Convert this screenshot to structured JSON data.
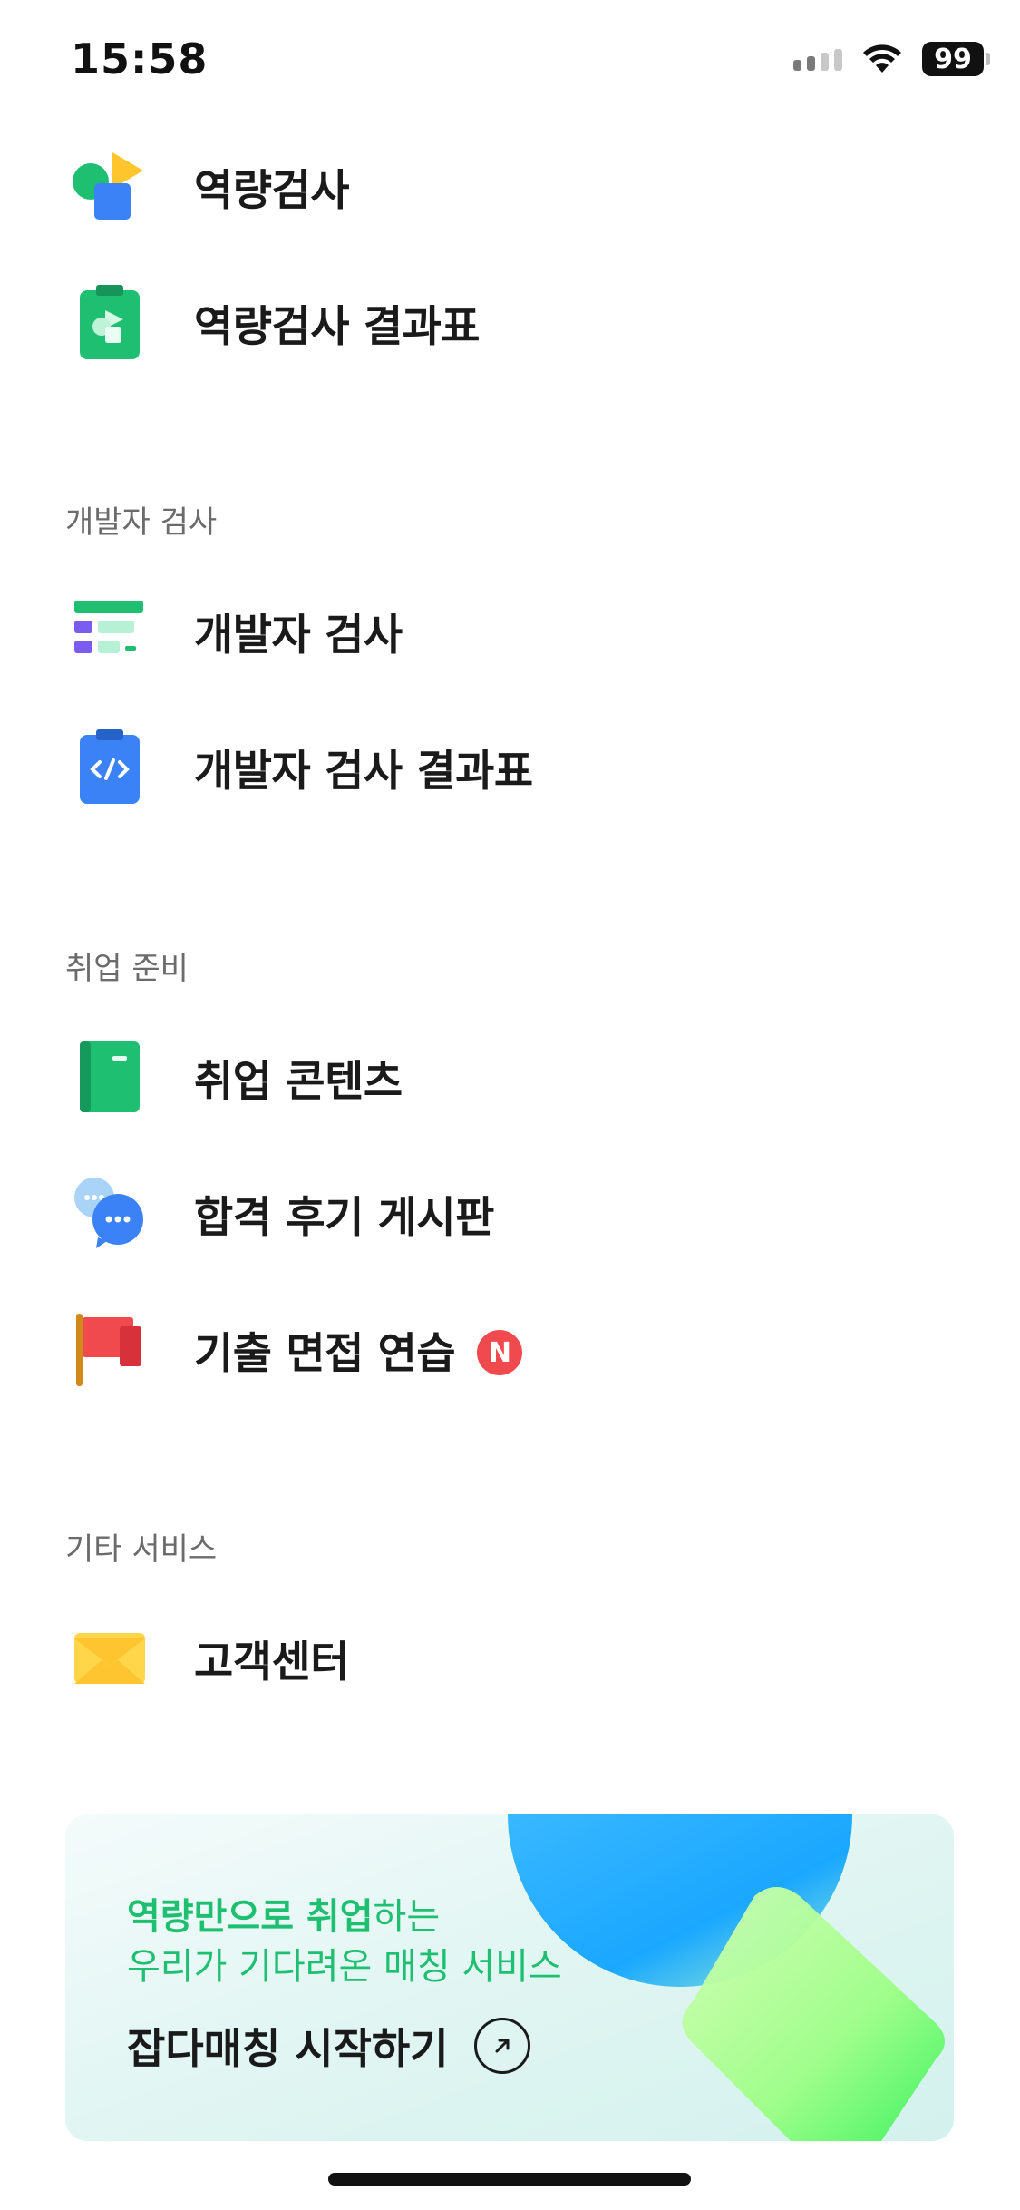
{
  "status_bar": {
    "time": "15:58",
    "battery": "99"
  },
  "menu": {
    "top_items": [
      {
        "label": "역량검사",
        "icon": "competency-test-icon"
      },
      {
        "label": "역량검사 결과표",
        "icon": "competency-result-icon"
      }
    ],
    "developer_section": {
      "title": "개발자 검사",
      "items": [
        {
          "label": "개발자 검사",
          "icon": "developer-test-icon"
        },
        {
          "label": "개발자 검사 결과표",
          "icon": "developer-result-icon"
        }
      ]
    },
    "job_prep_section": {
      "title": "취업 준비",
      "items": [
        {
          "label": "취업 콘텐츠",
          "icon": "book-icon"
        },
        {
          "label": "합격 후기 게시판",
          "icon": "chat-bubbles-icon"
        },
        {
          "label": "기출 면접 연습",
          "icon": "flag-icon",
          "badge": "N"
        }
      ]
    },
    "other_section": {
      "title": "기타 서비스",
      "items": [
        {
          "label": "고객센터",
          "icon": "envelope-icon"
        }
      ]
    }
  },
  "banner": {
    "highlight_1": "역량만으로 취업",
    "rest_1": "하는",
    "line_2": "우리가 기다려온 매칭 서비스",
    "cta": "잡다매칭 시작하기"
  },
  "colors": {
    "accent_green": "#1fbf71",
    "badge_red": "#f04a4f",
    "blue": "#3b82f6"
  }
}
